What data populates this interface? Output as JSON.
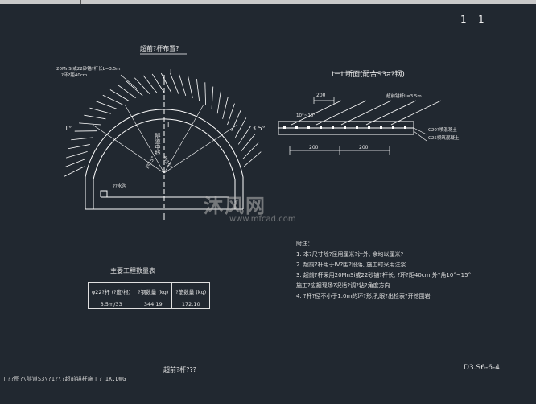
{
  "sheet": {
    "page_left": "1",
    "page_right": "1",
    "drawing_no": "D3.S6-6-4"
  },
  "plan": {
    "title": "超前?杆布置?",
    "callout_line1": "20MnSi或22砂锚?杆长L=3.5m",
    "callout_line2": "?环?距40cm",
    "section_mark_top": "I",
    "section_mark_bottom": "I",
    "left_angle": "1°",
    "right_angle": "3.5°",
    "center_text": "隧道中线",
    "angle_left": "约15°",
    "angle_right": "约15°",
    "floor_label": "??水沟"
  },
  "section": {
    "title": "I－I 断面(配合S3a?钢)",
    "spacing_top": "200",
    "angle_text": "10°~15°",
    "bolt_text": "超前锚杆L=3.5m",
    "layer1": "C20?喷混凝土",
    "layer2": "C25模筑混凝土",
    "dim1": "200",
    "dim2": "200"
  },
  "notes": {
    "heading": "附注：",
    "items": [
      "1. 本?尺寸除?径用厘米?计外, 余均以厘米?",
      "2. 超前?杆用于IV?围?段落, 施工时采用注浆",
      "3. 超前?杆采用20MnSi或22砂锚?杆长, ?环?距40cm,外?角10°~15°",
      "   施工?应据现场?况适?调?钻?角度方向",
      "4. ?杆?径不小于1.0m的环?形,孔眼?出检表?开挖围岩"
    ]
  },
  "qty_table": {
    "title": "主要工程数量表",
    "headers": [
      "φ22?杆 (?度/根)",
      "?钢数量 (kg)",
      "?筋数量 (kg)"
    ],
    "row": [
      "3.5m/33",
      "344.19",
      "172.10"
    ]
  },
  "footer": {
    "caption": "超前?杆???"
  },
  "status_bar": {
    "path": "工??图?\\隧道S3\\?1?\\?超前锚杆施工? IK.DWG"
  },
  "watermark": {
    "text": "沐风网",
    "url": "www.mfcad.com"
  },
  "colors": {
    "background": "#212830",
    "lines": "#ffffff",
    "dim": "#e0e0e0"
  }
}
